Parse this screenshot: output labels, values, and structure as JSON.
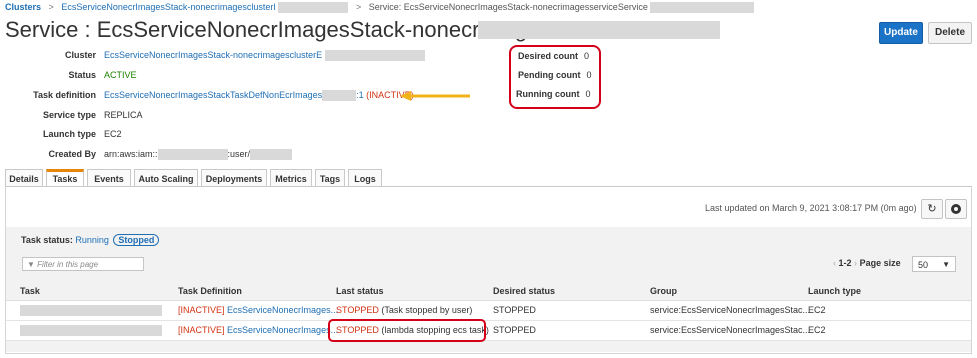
{
  "breadcrumb": {
    "root": "Clusters",
    "cluster": "EcsServiceNonecrImagesStack-nonecrimagesclusterI",
    "service": "Service: EcsServiceNonecrImagesStack-nonecrimagesserviceService"
  },
  "title": "Service : EcsServiceNonecrImagesStack-nonecrimagesserviceService",
  "buttons": {
    "update": "Update",
    "delete": "Delete"
  },
  "details": {
    "cluster": {
      "label": "Cluster",
      "value": "EcsServiceNonecrImagesStack-nonecrimagesclusterE"
    },
    "status": {
      "label": "Status",
      "value": "ACTIVE"
    },
    "task_definition": {
      "label": "Task definition",
      "value": "EcsServiceNonecrImagesStackTaskDefNonEcrImages",
      "suffix": ":1",
      "inactive": "(INACTIVE)"
    },
    "service_type": {
      "label": "Service type",
      "value": "REPLICA"
    },
    "launch_type": {
      "label": "Launch type",
      "value": "EC2"
    },
    "created_by": {
      "label": "Created By",
      "prefix": "arn:aws:iam::",
      "mid": ":user/"
    }
  },
  "counts": {
    "desired": {
      "label": "Desired count",
      "value": "0"
    },
    "pending": {
      "label": "Pending count",
      "value": "0"
    },
    "running": {
      "label": "Running count",
      "value": "0"
    }
  },
  "tabs": [
    "Details",
    "Tasks",
    "Events",
    "Auto Scaling",
    "Deployments",
    "Metrics",
    "Tags",
    "Logs"
  ],
  "active_tab": "Tasks",
  "last_updated": "Last updated on March 9, 2021 3:08:17 PM (0m ago)",
  "icons": {
    "refresh": "refresh-icon",
    "settings": "gear-icon",
    "filter": "filter-icon",
    "chevron": "chevron-down-icon"
  },
  "task_status": {
    "label": "Task status:",
    "running": "Running",
    "stopped": "Stopped"
  },
  "filter": {
    "placeholder": "Filter in this page"
  },
  "pager": {
    "prev": "‹",
    "range": "1-2",
    "next": "›",
    "page_size_label": "Page size",
    "page_size": "50"
  },
  "table": {
    "columns": [
      "Task",
      "Task Definition",
      "Last status",
      "Desired status",
      "Group",
      "Launch type"
    ],
    "rows": [
      {
        "task_def_prefix": "[INACTIVE]",
        "task_def": "EcsServiceNonecrImages...",
        "last_status": "STOPPED",
        "last_status_note": "(Task stopped by user)",
        "desired_status": "STOPPED",
        "group": "service:EcsServiceNonecrImagesStac...",
        "launch_type": "EC2"
      },
      {
        "task_def_prefix": "[INACTIVE]",
        "task_def": "EcsServiceNonecrImages...",
        "last_status": "STOPPED",
        "last_status_note": "(lambda stopping ecs task)",
        "desired_status": "STOPPED",
        "group": "service:EcsServiceNonecrImagesStac...",
        "launch_type": "EC2"
      }
    ]
  },
  "colors": {
    "accent": "#1a73c7",
    "link": "#1f6fb5",
    "inactive": "#d13212",
    "active": "#1d8102",
    "highlight": "#d4001a",
    "arrow": "#f2b21a",
    "tab_active": "#e8860c"
  }
}
